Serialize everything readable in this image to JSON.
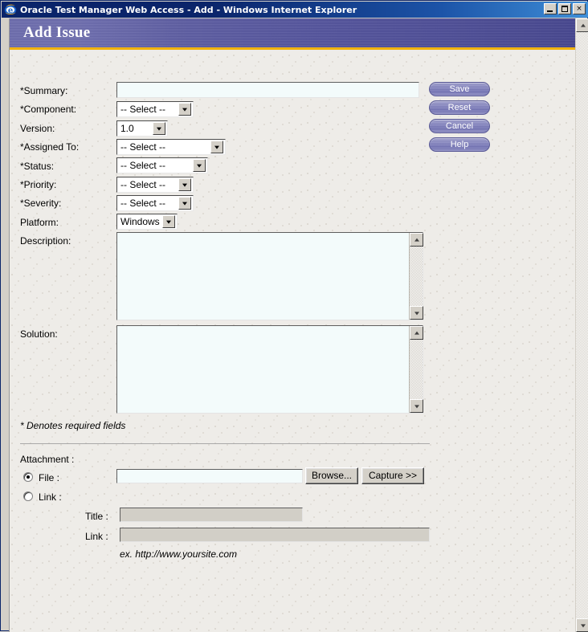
{
  "window": {
    "title": "Oracle Test Manager Web Access - Add - Windows Internet Explorer",
    "icon": "internet-explorer-icon",
    "buttons": {
      "minimize": "_",
      "maximize": "□",
      "close": "×"
    }
  },
  "banner": {
    "title": "Add Issue",
    "gradient_start": "#6a6aab",
    "gradient_end": "#42428c",
    "accent_color": "#f0b20a"
  },
  "form": {
    "fields": [
      {
        "label": "*Summary:",
        "type": "text",
        "value": ""
      },
      {
        "label": "*Component:",
        "type": "select",
        "value": "-- Select --"
      },
      {
        "label": "Version:",
        "type": "select",
        "value": "1.0"
      },
      {
        "label": "*Assigned To:",
        "type": "select",
        "value": "-- Select --"
      },
      {
        "label": "*Status:",
        "type": "select",
        "value": "-- Select --"
      },
      {
        "label": "*Priority:",
        "type": "select",
        "value": "-- Select --"
      },
      {
        "label": "*Severity:",
        "type": "select",
        "value": "-- Select --"
      },
      {
        "label": "Platform:",
        "type": "select",
        "value": "Windows"
      },
      {
        "label": "Description:",
        "type": "textarea",
        "value": ""
      },
      {
        "label": "Solution:",
        "type": "textarea",
        "value": ""
      }
    ],
    "required_note": "* Denotes required fields"
  },
  "actions": {
    "save": "Save",
    "reset": "Reset",
    "cancel": "Cancel",
    "help": "Help"
  },
  "attachment": {
    "heading": "Attachment :",
    "file_label": "File :",
    "file_value": "",
    "file_selected": true,
    "browse_label": "Browse...",
    "capture_label": "Capture >>",
    "link_label": "Link :",
    "link_selected": false,
    "title_label": "Title :",
    "title_value": "",
    "link_url_label": "Link :",
    "link_url_value": "",
    "example": "ex. http://www.yoursite.com"
  }
}
